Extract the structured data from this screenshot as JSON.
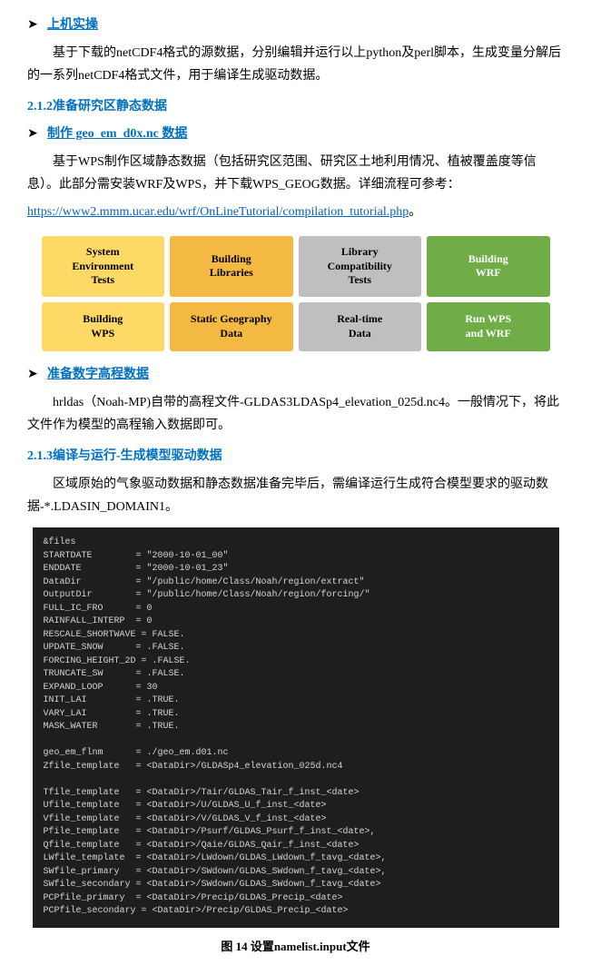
{
  "top": {
    "bullet_label": "上机实操",
    "para1": "基于下载的netCDF4格式的源数据，分别编辑并运行以上python及perl脚本，生成变量分解后的一系列netCDF4格式文件，用于编译生成驱动数据。"
  },
  "section212": {
    "heading": "2.1.2准备研究区静态数据",
    "bullet_label": "制作 geo_em_d0x.nc 数据",
    "para1": "基于WPS制作区域静态数据（包括研究区范围、研究区土地利用情况、植被覆盖度等信息）。此部分需安装WRF及WPS，并下载WPS_GEOG数据。详细流程可参考：",
    "link": "https://www2.mmm.ucar.edu/wrf/OnLineTutorial/compilation_tutorial.php",
    "link_suffix": "。"
  },
  "grid": {
    "cells": [
      {
        "label": "System\nEnvironment\nTests",
        "style": "cell-yellow"
      },
      {
        "label": "Building\nLibraries",
        "style": "cell-orange"
      },
      {
        "label": "Library\nCompatibility\nTests",
        "style": "cell-gray"
      },
      {
        "label": "Building\nWRF",
        "style": "cell-green"
      },
      {
        "label": "Building\nWPS",
        "style": "cell-yellow"
      },
      {
        "label": "Static Geography\nData",
        "style": "cell-orange"
      },
      {
        "label": "Real-time\nData",
        "style": "cell-gray"
      },
      {
        "label": "Run WPS\nand WRF",
        "style": "cell-green"
      }
    ]
  },
  "section_dem": {
    "bullet_label": "准备数字高程数据",
    "para1": "hrldas（Noah-MP)自带的高程文件-GLDAS3LDASp4_elevation_025d.nc4。一般情况下，将此文件作为模型的高程输入数据即可。"
  },
  "section213": {
    "heading": "2.1.3编译与运行-生成模型驱动数据",
    "para1": "区域原始的气象驱动数据和静态数据准备完毕后，需编译运行生成符合模型要求的驱动数据-*.LDASIN_DOMAIN1。"
  },
  "code": {
    "content": "&files\nSTARTDATE        = \"2000-10-01_00\"\nENDDATE          = \"2000-10-01_23\"\nDataDir          = \"/public/home/Class/Noah/region/extract\"\nOutputDir        = \"/public/home/Class/Noah/region/forcing/\"\nFULL_IC_FRO      = 0\nRAINFALL_INTERP  = 0\nRESCALE_SHORTWAVE = FALSE.\nUPDATE_SNOW      = .FALSE.\nFORCING_HEIGHT_2D = .FALSE.\nTRUNCATE_SW      = .FALSE.\nEXPAND_LOOP      = 30\nINIT_LAI         = .TRUE.\nVARY_LAI         = .TRUE.\nMASK_WATER       = .TRUE.\n\ngeo_em_flnm      = ./geo_em.d01.nc\nZfile_template   = <DataDir>/GLDASp4_elevation_025d.nc4\n\nTfile_template   = <DataDir>/Tair/GLDAS_Tair_f_inst_<date>\nUfile_template   = <DataDir>/U/GLDAS_U_f_inst_<date>\nVfile_template   = <DataDir>/V/GLDAS_V_f_inst_<date>\nPfile_template   = <DataDir>/Psurf/GLDAS_Psurf_f_inst_<date>,\nQfile_template   = <DataDir>/Qaie/GLDAS_Qair_f_inst_<date>\nLWfile_template  = <DataDir>/LWdown/GLDAS_LWdown_f_tavg_<date>,\nSWfile_primary   = <DataDir>/SWdown/GLDAS_SWdown_f_tavg_<date>,\nSWfile_secondary = <DataDir>/SWdown/GLDAS_SWdown_f_tavg_<date>\nPCPfile_primary  = <DataDir>/Precip/GLDAS_Precip_<date>\nPCPfile_secondary = <DataDir>/Precip/GLDAS_Precip_<date>"
  },
  "fig_caption": "图 14 设置namelist.input文件"
}
